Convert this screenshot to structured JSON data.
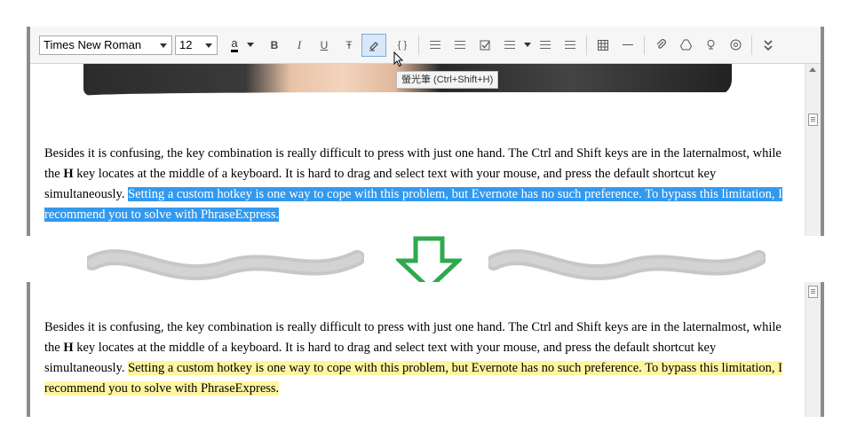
{
  "toolbar": {
    "font_family": "Times New Roman",
    "font_size": "12",
    "color_glyph": "a",
    "bold": "B",
    "italic": "I",
    "underline": "U",
    "strikethrough": "Ŧ",
    "code": "{ }"
  },
  "tooltip": "螢光筆 (Ctrl+Shift+H)",
  "paragraph": {
    "part1": "Besides it is confusing, the key combination is really difficult to press with just one hand. The Ctrl and Shift keys are in the laternalmost, while the ",
    "bold_key": "H",
    "part2": " key locates at the middle of a keyboard. It is hard to drag and select text with your mouse, and press the default shortcut key simultaneously.",
    "highlighted": "Setting a custom hotkey is one way to cope with this problem, but Evernote has no such preference. To bypass this limitation, I recommend you to solve with PhraseExpress."
  },
  "colors": {
    "selection": "#3399ee",
    "highlight": "#fff5a0",
    "arrow": "#2fa84f"
  },
  "icons": [
    "chevron-down-icon",
    "font-color-icon",
    "highlighter-icon",
    "code-icon",
    "bulleted-list-icon",
    "numbered-list-icon",
    "checkbox-icon",
    "align-icon",
    "outdent-icon",
    "indent-icon",
    "table-icon",
    "horizontal-rule-icon",
    "attachment-icon",
    "drive-icon",
    "encrypt-icon",
    "settings-icon",
    "more-icon",
    "down-arrow-icon"
  ]
}
